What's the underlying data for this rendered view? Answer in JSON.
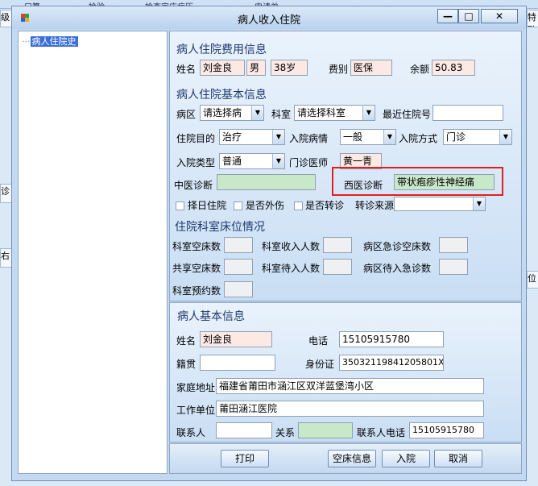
{
  "window": {
    "title": "病人收入住院"
  },
  "background": {
    "top_tabs": [
      "口算",
      "检验",
      "检查字床病历",
      "申请单"
    ],
    "left_snippets": [
      "级",
      "诊",
      "右"
    ],
    "right_snippets": [
      "特殊",
      "位"
    ]
  },
  "tree": {
    "item": "病人住院史"
  },
  "cost": {
    "header": "病人住院费用信息",
    "name_label": "姓名",
    "name": "刘金良",
    "sex": "男",
    "age": "38岁",
    "fee_type_label": "费别",
    "fee_type": "医保",
    "balance_label": "余额",
    "balance": "50.83"
  },
  "basic": {
    "header": "病人住院基本信息",
    "ward_label": "病区",
    "ward": "请选择病",
    "dept_label": "科室",
    "dept": "请选择科室",
    "recent_no_label": "最近住院号",
    "recent_no": "",
    "purpose_label": "住院目的",
    "purpose": "治疗",
    "condition_label": "入院病情",
    "condition": "一般",
    "method_label": "入院方式",
    "method": "门诊",
    "type_label": "入院类型",
    "type": "普通",
    "doctor_label": "门诊医师",
    "doctor": "黄一青",
    "tcm_label": "中医诊断",
    "tcm": "",
    "wm_label": "西医诊断",
    "wm": "带状疱疹性神经痛",
    "chk1": "择日住院",
    "chk2": "是否外伤",
    "chk3": "是否转诊",
    "transfer_label": "转诊来源",
    "transfer": ""
  },
  "beds": {
    "header": "住院科室床位情况",
    "l1": "科室空床数",
    "l2": "科室收入人数",
    "l3": "病区急诊空床数",
    "l4": "共享空床数",
    "l5": "科室待入人数",
    "l6": "病区待入急诊数",
    "l7": "科室预约数"
  },
  "patient": {
    "header": "病人基本信息",
    "name_label": "姓名",
    "name": "刘金良",
    "phone_label": "电话",
    "phone": "15105915780",
    "native_label": "籍贯",
    "native": "",
    "id_label": "身份证",
    "id": "35032119841205801X",
    "address_label": "家庭地址",
    "address": "福建省莆田市涵江区双洋蓝堡湾小区",
    "work_label": "工作单位",
    "work": "莆田涵江医院",
    "contact_label": "联系人",
    "contact": "",
    "relation_label": "关系",
    "relation": "",
    "contact_phone_label": "联系人电话",
    "contact_phone": "15105915780"
  },
  "buttons": {
    "print": "打印",
    "empty_bed": "空床信息",
    "admit": "入院",
    "cancel": "取消"
  }
}
